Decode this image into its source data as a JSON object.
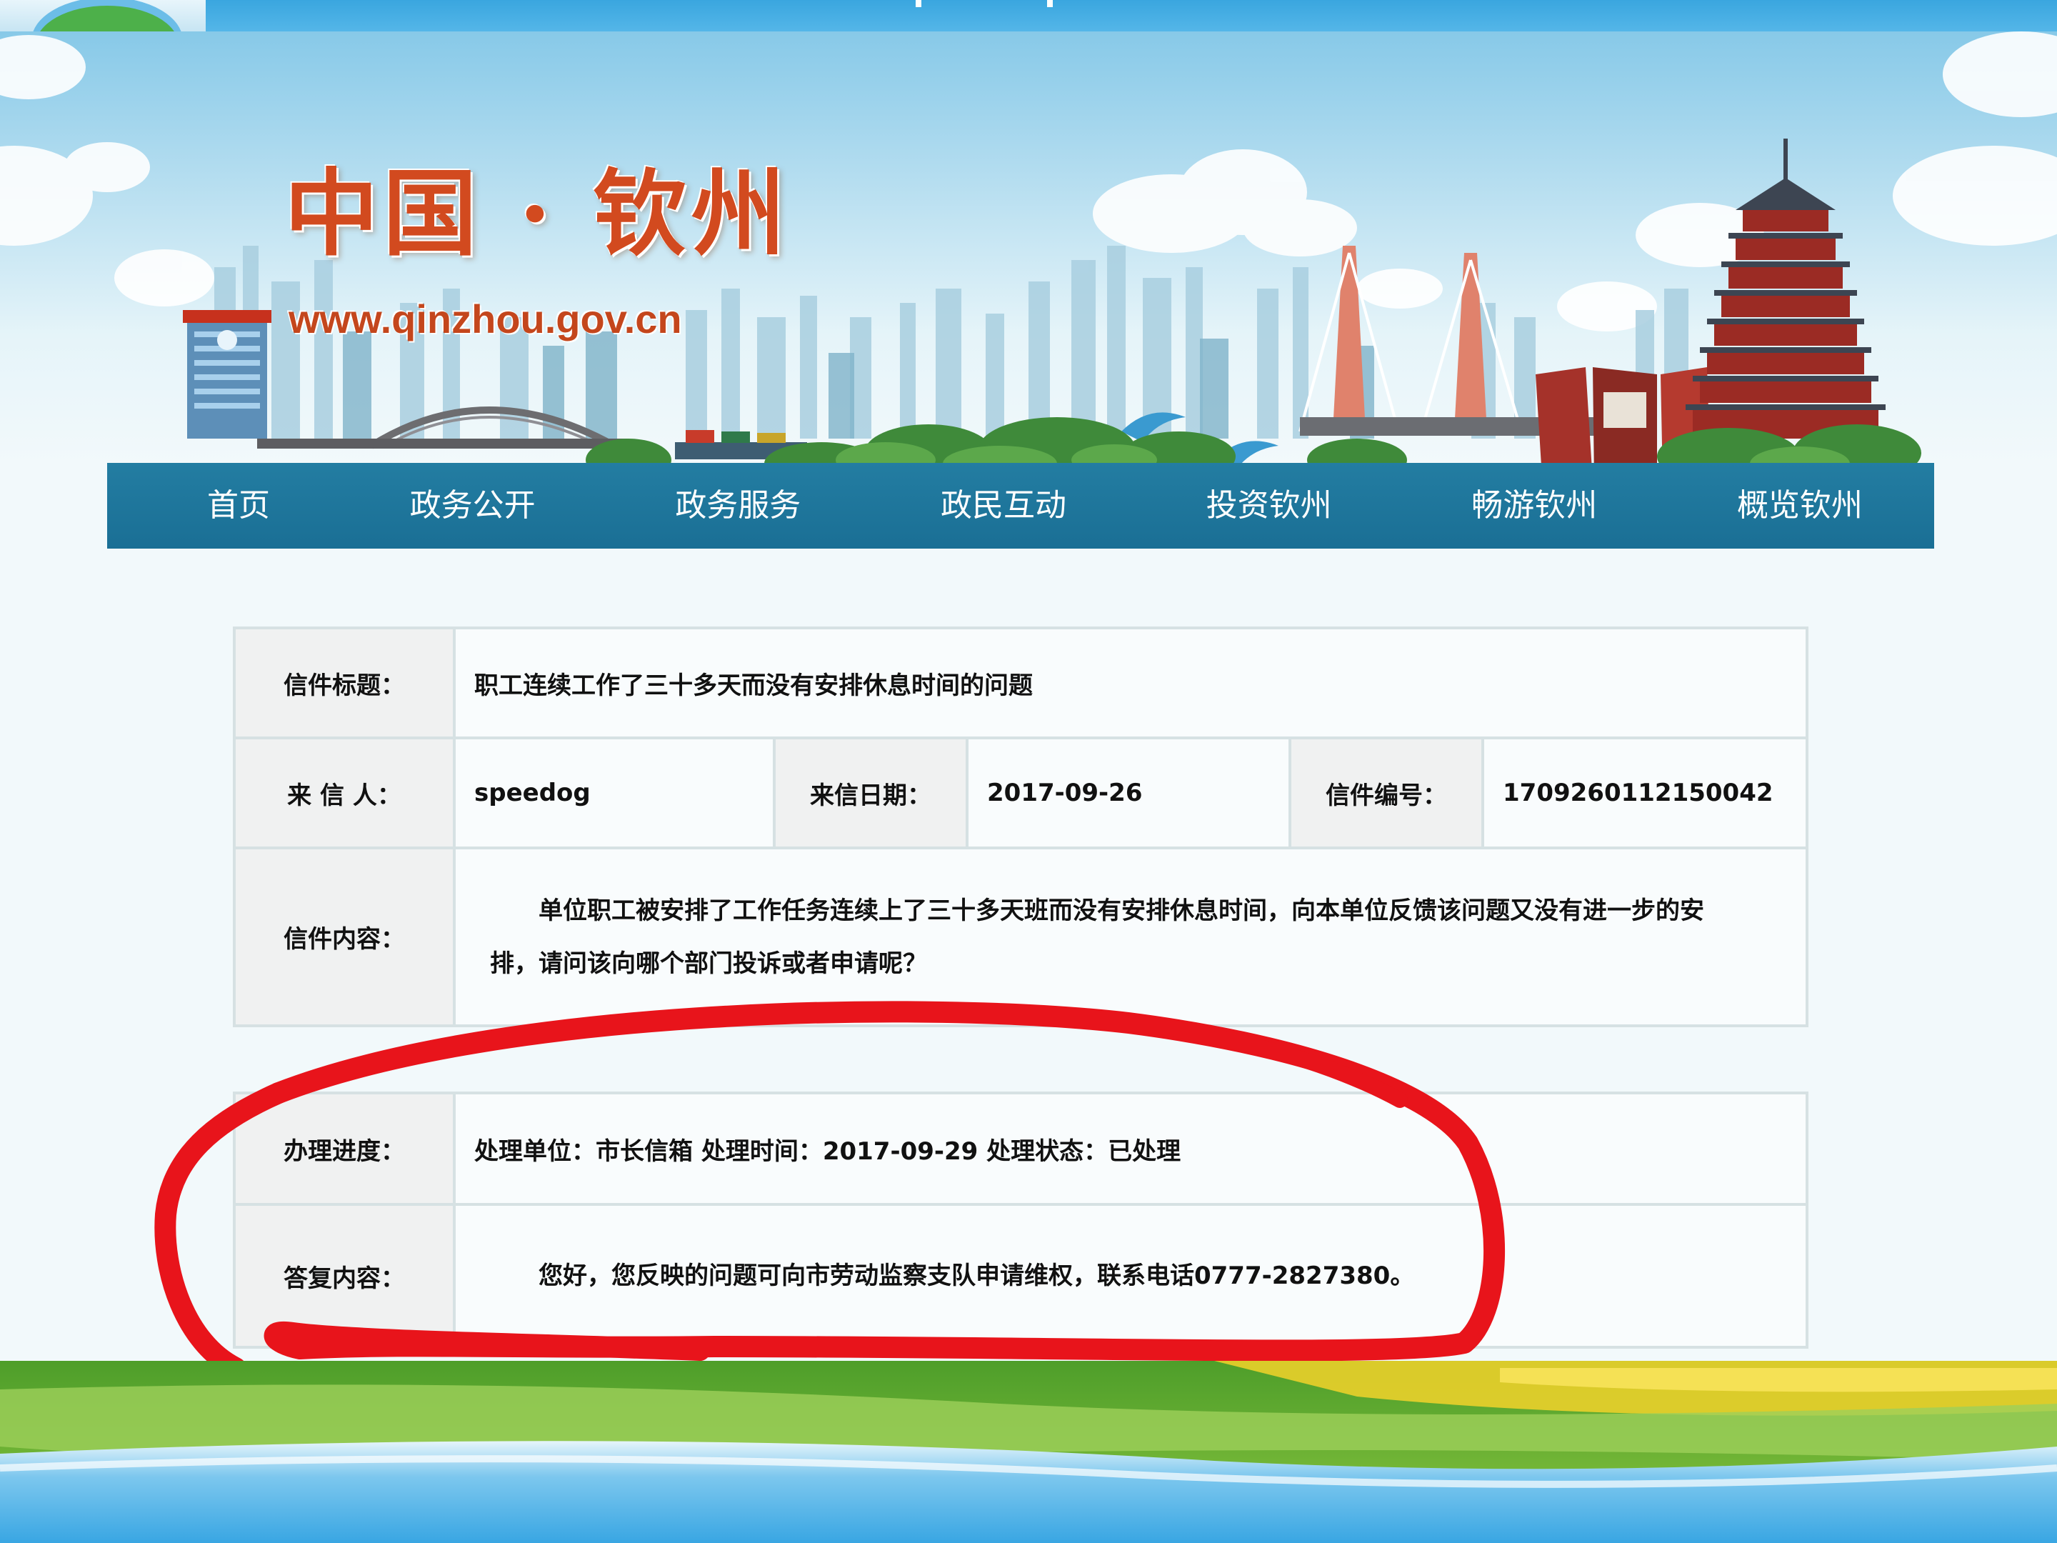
{
  "site": {
    "title": "中国 · 钦州",
    "url": "www.qinzhou.gov.cn"
  },
  "nav": {
    "items": [
      "首页",
      "政务公开",
      "政务服务",
      "政民互动",
      "投资钦州",
      "畅游钦州",
      "概览钦州"
    ]
  },
  "letter": {
    "title_label": "信件标题：",
    "title_value": "职工连续工作了三十多天而没有安排休息时间的问题",
    "sender_label": "来 信 人：",
    "sender_value": "speedog",
    "date_label": "来信日期：",
    "date_value": "2017-09-26",
    "number_label": "信件编号：",
    "number_value": "1709260112150042",
    "content_label": "信件内容：",
    "content_value": "单位职工被安排了工作任务连续上了三十多天班而没有安排休息时间，向本单位反馈该问题又没有进一步的安排，请问该向哪个部门投诉或者申请呢？"
  },
  "reply": {
    "progress_label": "办理进度：",
    "progress_value": "处理单位：市长信箱 处理时间：2017-09-29 处理状态：已处理",
    "content_label": "答复内容：",
    "content_value": "您好，您反映的问题可向市劳动监察支队申请维权，联系电话0777-2827380。"
  },
  "colors": {
    "nav_bg": "#1a6f95",
    "title_red": "#d24a1f",
    "annotation_red": "#e8141b",
    "border": "#d6e1e3"
  }
}
